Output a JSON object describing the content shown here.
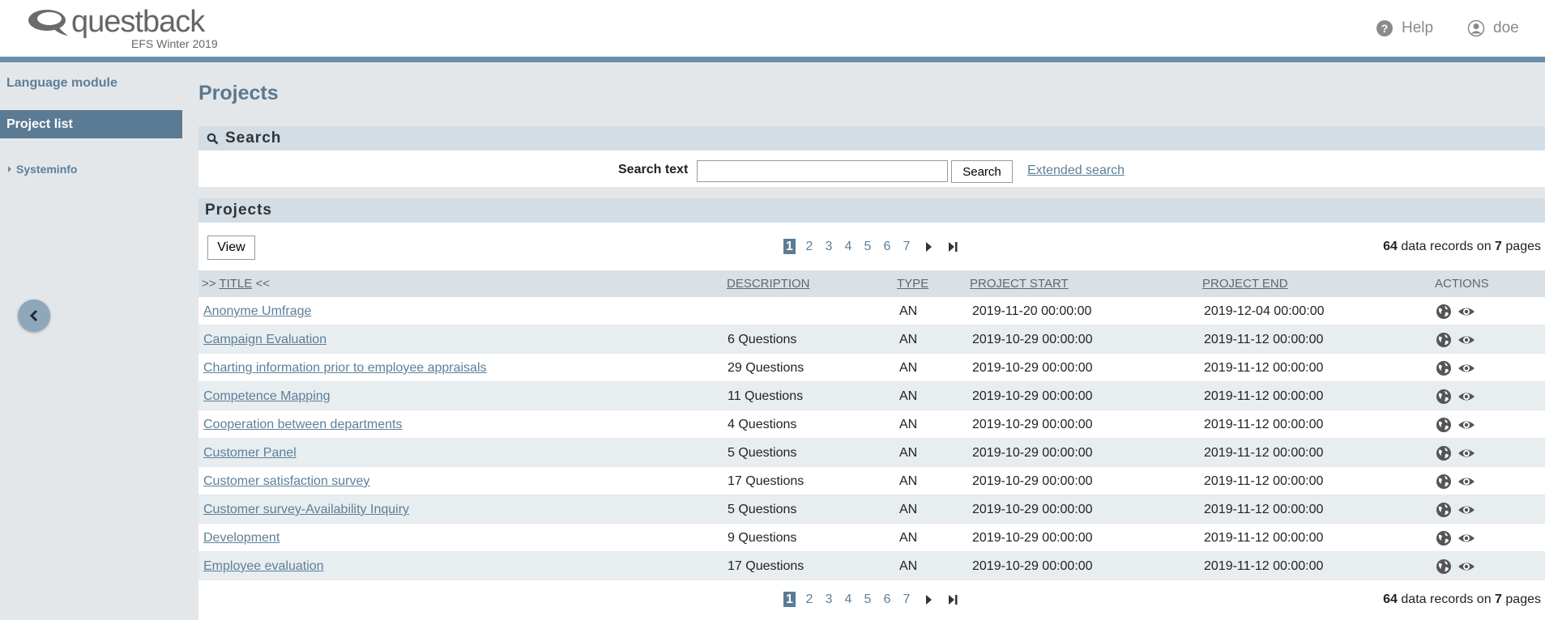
{
  "app": {
    "logo_text": "questback",
    "logo_sub": "EFS Winter 2019",
    "help_label": "Help",
    "user_label": "doe"
  },
  "sidebar": {
    "items": [
      {
        "label": "Language module"
      },
      {
        "label": "Project list"
      },
      {
        "label": "Systeminfo"
      }
    ]
  },
  "main": {
    "title": "Projects",
    "search": {
      "section_title": "Search",
      "label": "Search text",
      "value": "",
      "button": "Search",
      "extended_link": "Extended search"
    },
    "projects": {
      "section_title": "Projects",
      "view_button": "View",
      "pages": [
        "1",
        "2",
        "3",
        "4",
        "5",
        "6",
        "7"
      ],
      "current_page": "1",
      "records_count": "64",
      "records_mid": "data records on",
      "pages_count": "7",
      "records_tail": "pages"
    }
  },
  "table": {
    "headers": {
      "title_prefix": ">>",
      "title": "TITLE",
      "title_suffix": "<<",
      "description": "DESCRIPTION",
      "type": "TYPE",
      "start": "PROJECT START",
      "end": "PROJECT END",
      "actions": "ACTIONS"
    },
    "rows": [
      {
        "title": "Anonyme Umfrage",
        "description": "",
        "type": "AN",
        "start": "2019-11-20 00:00:00",
        "end": "2019-12-04 00:00:00"
      },
      {
        "title": "Campaign Evaluation",
        "description": "6 Questions",
        "type": "AN",
        "start": "2019-10-29 00:00:00",
        "end": "2019-11-12 00:00:00"
      },
      {
        "title": "Charting information prior to employee appraisals",
        "description": "29 Questions",
        "type": "AN",
        "start": "2019-10-29 00:00:00",
        "end": "2019-11-12 00:00:00"
      },
      {
        "title": "Competence Mapping",
        "description": "11 Questions",
        "type": "AN",
        "start": "2019-10-29 00:00:00",
        "end": "2019-11-12 00:00:00"
      },
      {
        "title": "Cooperation between departments",
        "description": "4 Questions",
        "type": "AN",
        "start": "2019-10-29 00:00:00",
        "end": "2019-11-12 00:00:00"
      },
      {
        "title": "Customer Panel",
        "description": "5 Questions",
        "type": "AN",
        "start": "2019-10-29 00:00:00",
        "end": "2019-11-12 00:00:00"
      },
      {
        "title": "Customer satisfaction survey",
        "description": "17 Questions",
        "type": "AN",
        "start": "2019-10-29 00:00:00",
        "end": "2019-11-12 00:00:00"
      },
      {
        "title": "Customer survey-Availability Inquiry",
        "description": "5 Questions",
        "type": "AN",
        "start": "2019-10-29 00:00:00",
        "end": "2019-11-12 00:00:00"
      },
      {
        "title": "Development",
        "description": "9 Questions",
        "type": "AN",
        "start": "2019-10-29 00:00:00",
        "end": "2019-11-12 00:00:00"
      },
      {
        "title": "Employee evaluation",
        "description": "17 Questions",
        "type": "AN",
        "start": "2019-10-29 00:00:00",
        "end": "2019-11-12 00:00:00"
      }
    ]
  },
  "colors": {
    "accent": "#5b7b94",
    "link": "#5c7f9a",
    "section_bar": "#d2dde5"
  }
}
